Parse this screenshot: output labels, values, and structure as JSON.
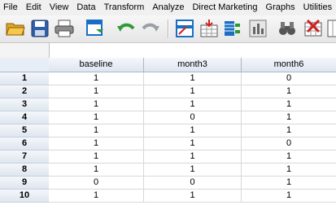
{
  "menu": [
    "File",
    "Edit",
    "View",
    "Data",
    "Transform",
    "Analyze",
    "Direct Marketing",
    "Graphs",
    "Utilities"
  ],
  "toolbar_icons": [
    "open-folder-icon",
    "save-icon",
    "print-icon",
    "recall-dialog-icon",
    "undo-icon",
    "redo-icon",
    "goto-case-icon",
    "goto-variable-icon",
    "variables-icon",
    "run-descriptives-icon",
    "find-icon",
    "insert-cases-icon",
    "insert-variable-icon"
  ],
  "grid": {
    "columns": [
      "baseline",
      "month3",
      "month6"
    ],
    "rows": [
      {
        "num": "1",
        "values": [
          "1",
          "1",
          "0"
        ]
      },
      {
        "num": "2",
        "values": [
          "1",
          "1",
          "1"
        ]
      },
      {
        "num": "3",
        "values": [
          "1",
          "1",
          "1"
        ]
      },
      {
        "num": "4",
        "values": [
          "1",
          "0",
          "1"
        ]
      },
      {
        "num": "5",
        "values": [
          "1",
          "1",
          "1"
        ]
      },
      {
        "num": "6",
        "values": [
          "1",
          "1",
          "0"
        ]
      },
      {
        "num": "7",
        "values": [
          "1",
          "1",
          "1"
        ]
      },
      {
        "num": "8",
        "values": [
          "1",
          "1",
          "1"
        ]
      },
      {
        "num": "9",
        "values": [
          "0",
          "0",
          "1"
        ]
      },
      {
        "num": "10",
        "values": [
          "1",
          "1",
          "1"
        ]
      }
    ]
  },
  "colors": {
    "accent": "#1a6fc4",
    "header_bg": "#dfe6f0",
    "grid_line": "#d8d8d8"
  }
}
